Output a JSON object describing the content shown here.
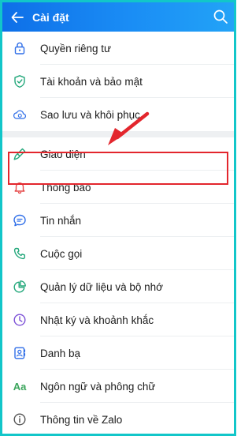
{
  "header": {
    "title": "Cài đặt"
  },
  "settings": {
    "group1": [
      {
        "label": "Quyền riêng tư",
        "icon": "lock-icon"
      },
      {
        "label": "Tài khoản và bảo mật",
        "icon": "shield-icon"
      },
      {
        "label": "Sao lưu và khôi phục",
        "icon": "cloud-backup-icon"
      }
    ],
    "group2": [
      {
        "label": "Giao diện",
        "icon": "brush-icon"
      },
      {
        "label": "Thông báo",
        "icon": "bell-icon"
      },
      {
        "label": "Tin nhắn",
        "icon": "chat-bubble-icon"
      },
      {
        "label": "Cuộc gọi",
        "icon": "phone-icon"
      },
      {
        "label": "Quản lý dữ liệu và bộ nhớ",
        "icon": "pie-chart-icon"
      },
      {
        "label": "Nhật ký và khoảnh khắc",
        "icon": "clock-icon"
      },
      {
        "label": "Danh bạ",
        "icon": "contacts-icon"
      },
      {
        "label": "Ngôn ngữ và phông chữ",
        "icon": "font-icon",
        "glyph": "Aa"
      },
      {
        "label": "Thông tin về Zalo",
        "icon": "info-icon"
      }
    ]
  },
  "colors": {
    "header_start": "#0e6fe8",
    "header_end": "#22a3f7",
    "highlight_border": "#e3262d",
    "frame_border": "#12c6c9"
  }
}
